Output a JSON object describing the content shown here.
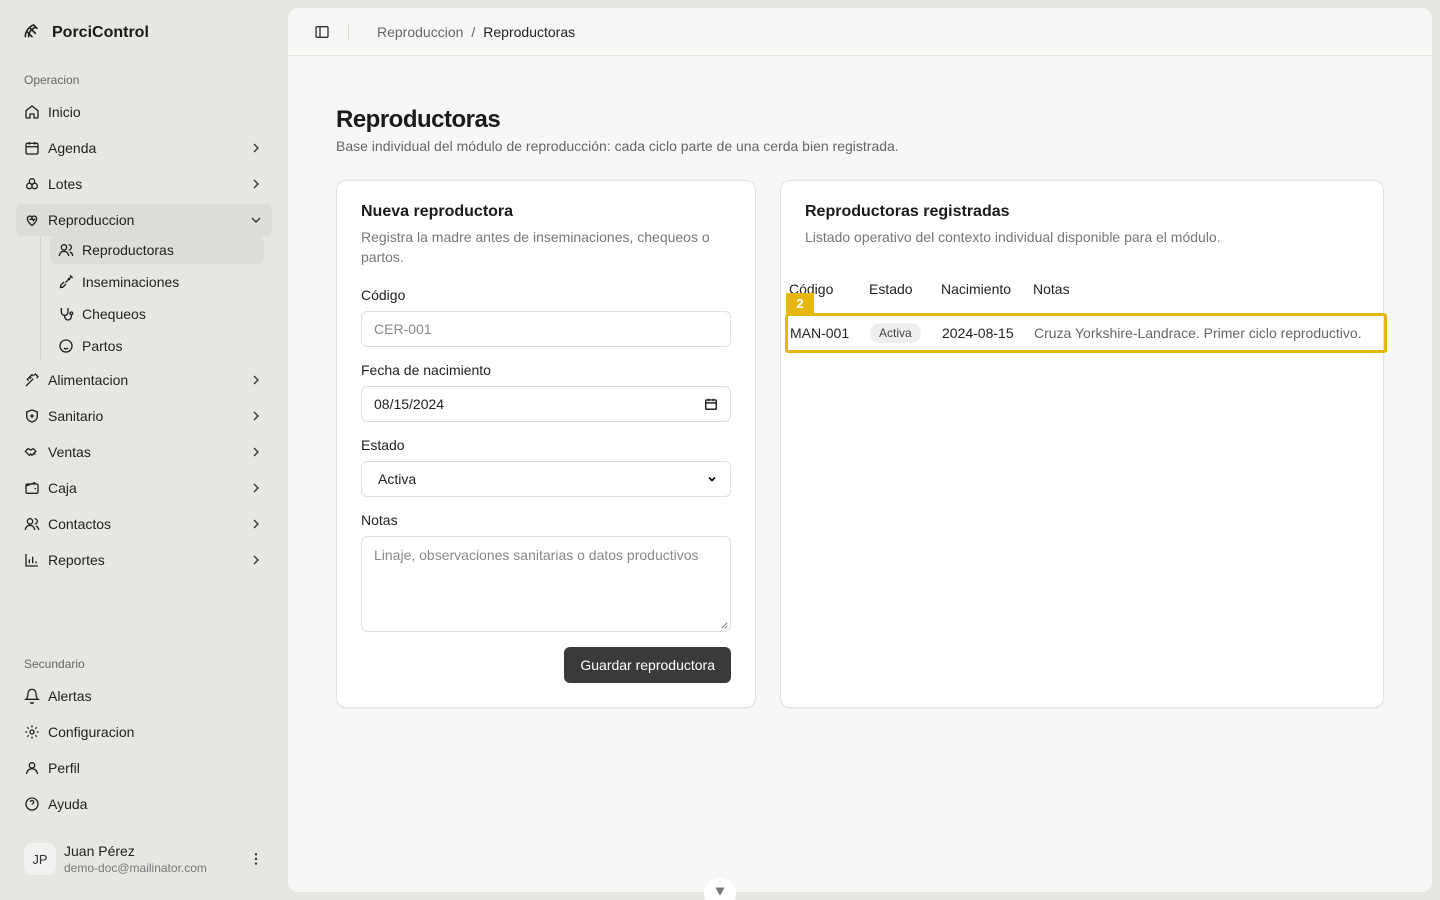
{
  "app": {
    "name": "PorciControl"
  },
  "sidebar": {
    "section_primary": "Operacion",
    "section_secondary": "Secundario",
    "items": [
      {
        "label": "Inicio"
      },
      {
        "label": "Agenda"
      },
      {
        "label": "Lotes"
      },
      {
        "label": "Reproduccion"
      },
      {
        "label": "Alimentacion"
      },
      {
        "label": "Sanitario"
      },
      {
        "label": "Ventas"
      },
      {
        "label": "Caja"
      },
      {
        "label": "Contactos"
      },
      {
        "label": "Reportes"
      }
    ],
    "subitems": [
      {
        "label": "Reproductoras"
      },
      {
        "label": "Inseminaciones"
      },
      {
        "label": "Chequeos"
      },
      {
        "label": "Partos"
      }
    ],
    "secondary_items": [
      {
        "label": "Alertas"
      },
      {
        "label": "Configuracion"
      },
      {
        "label": "Perfil"
      },
      {
        "label": "Ayuda"
      }
    ],
    "user": {
      "initials": "JP",
      "name": "Juan Pérez",
      "email": "demo-doc@mailinator.com"
    }
  },
  "breadcrumb": {
    "parent": "Reproduccion",
    "separator": "/",
    "current": "Reproductoras"
  },
  "page": {
    "title": "Reproductoras",
    "subtitle": "Base individual del módulo de reproducción: cada ciclo parte de una cerda bien registrada."
  },
  "form": {
    "title": "Nueva reproductora",
    "description": "Registra la madre antes de inseminaciones, chequeos o partos.",
    "code_label": "Código",
    "code_placeholder": "CER-001",
    "birth_label": "Fecha de nacimiento",
    "birth_value": "08/15/2024",
    "status_label": "Estado",
    "status_value": "Activa",
    "notes_label": "Notas",
    "notes_placeholder": "Linaje, observaciones sanitarias o datos productivos",
    "submit_label": "Guardar reproductora"
  },
  "list": {
    "title": "Reproductoras registradas",
    "description": "Listado operativo del contexto individual disponible para el módulo.",
    "headers": [
      "Código",
      "Estado",
      "Nacimiento",
      "Notas"
    ],
    "rows": [
      {
        "code": "MAN-001",
        "status": "Activa",
        "birth": "2024-08-15",
        "notes": "Cruza Yorkshire-Landrace. Primer ciclo reproductivo."
      }
    ],
    "marker": "2"
  },
  "colors": {
    "highlight": "#e6b80f",
    "button": "#3a3a3a"
  }
}
